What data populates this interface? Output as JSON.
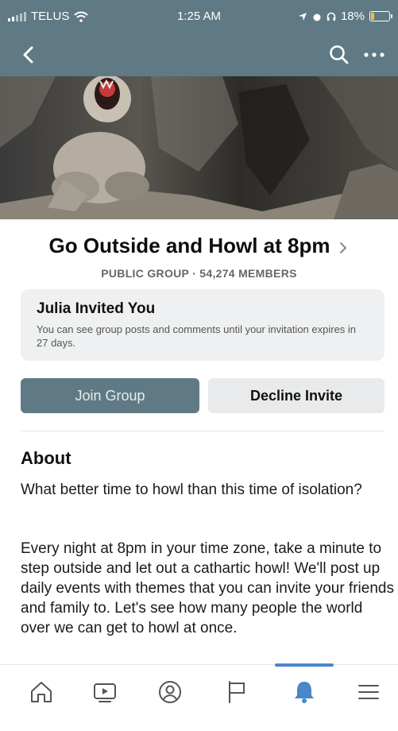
{
  "status_bar": {
    "carrier": "TELUS",
    "time": "1:25 AM",
    "battery": "18%",
    "battery_level": 0.18
  },
  "nav": {
    "back_icon": "chevron-left-icon",
    "search_icon": "search-icon",
    "more_icon": "more-dots-icon"
  },
  "group": {
    "title": "Go Outside and Howl at 8pm",
    "subtitle": "PUBLIC GROUP · 54,274 MEMBERS"
  },
  "invite": {
    "title": "Julia Invited You",
    "body": "You can see group posts and comments until your invitation expires in 27 days."
  },
  "actions": {
    "join_label": "Join Group",
    "decline_label": "Decline Invite"
  },
  "about": {
    "heading": "About",
    "paragraph1": "What better time to howl than this time of isolation?",
    "paragraph2": "Every night at 8pm in your time zone, take a minute to step outside and let out a cathartic howl! We'll post up daily events with themes that you can invite your friends and family to. Let's see how many people the world over we can get to howl at once."
  },
  "tab_bar": {
    "tabs": [
      "home-icon",
      "video-icon",
      "profile-icon",
      "flag-icon",
      "bell-icon",
      "menu-icon"
    ],
    "active": "bell-icon"
  },
  "colors": {
    "header": "#5f7a84",
    "join_button": "#5f7a84",
    "decline_button": "#e8eaec",
    "active_tab": "#4a86c8",
    "battery": "#f3c02b"
  }
}
